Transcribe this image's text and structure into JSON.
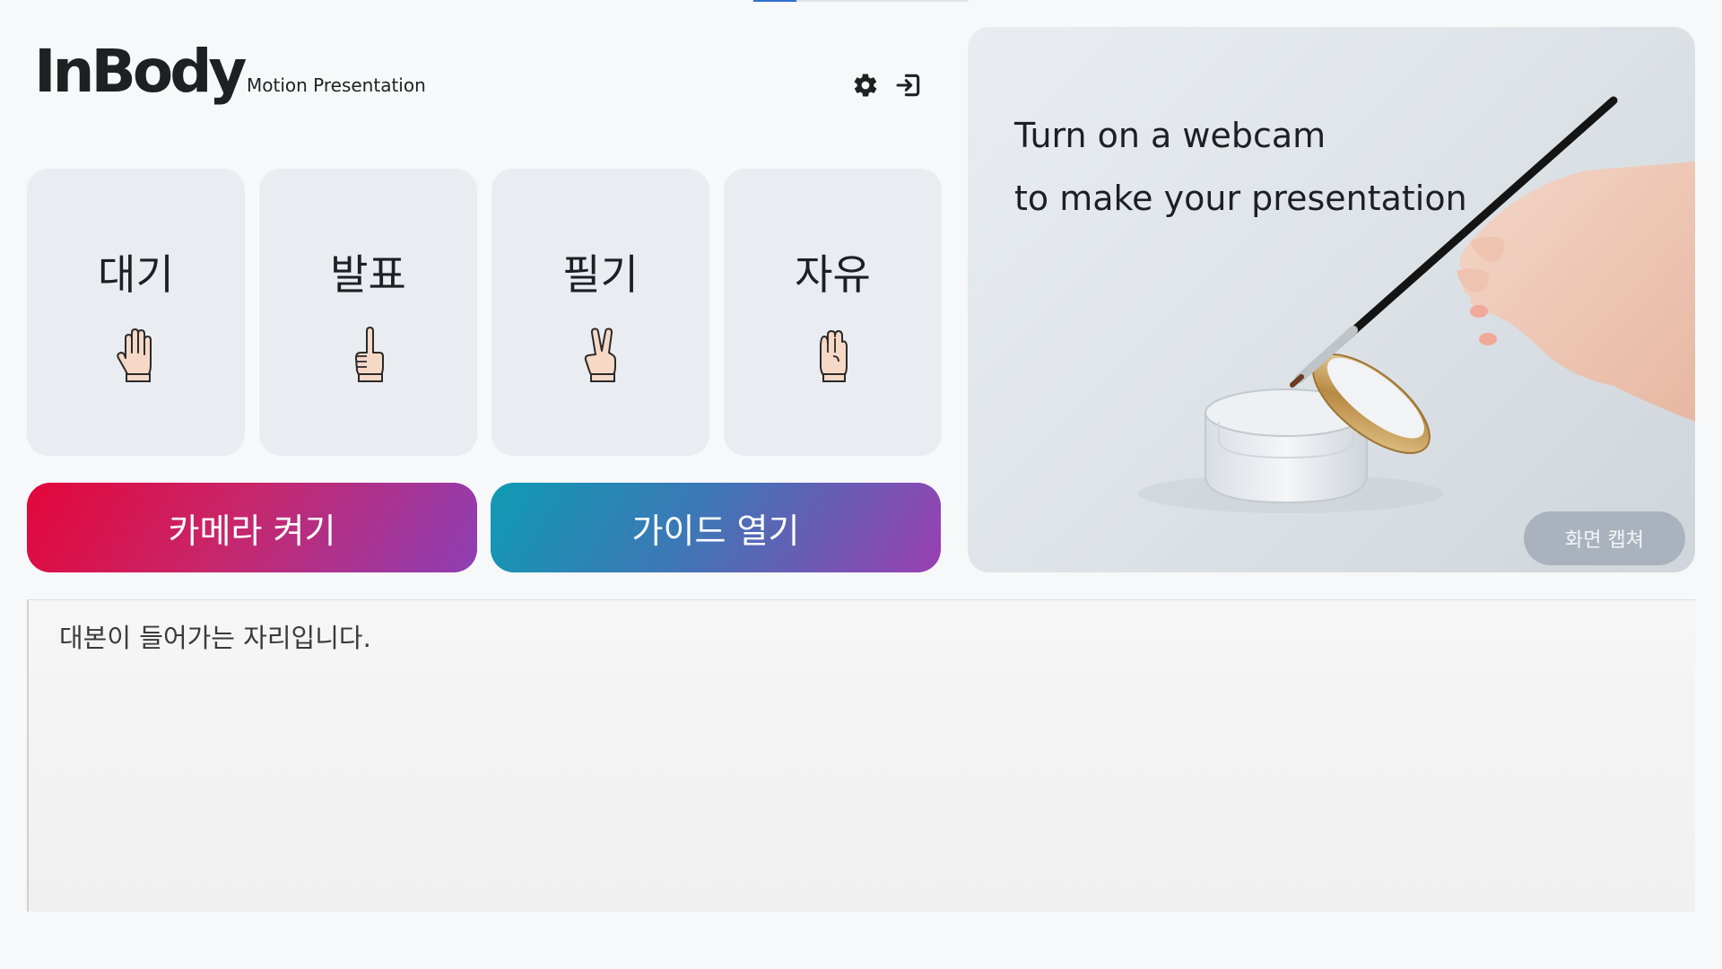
{
  "header": {
    "logo_text": "InBody",
    "subtitle": "Motion Presentation",
    "settings_icon": "gear-icon",
    "logout_icon": "sign-in-arrow-icon"
  },
  "modes": [
    {
      "label": "대기",
      "icon": "open-hand-icon"
    },
    {
      "label": "발표",
      "icon": "pointing-finger-icon"
    },
    {
      "label": "필기",
      "icon": "victory-hand-icon"
    },
    {
      "label": "자유",
      "icon": "fist-hand-icon"
    }
  ],
  "actions": {
    "camera_label": "카메라 켜기",
    "guide_label": "가이드 열기"
  },
  "preview": {
    "line1": "Turn on a webcam",
    "line2": "to make your presentation",
    "capture_label": "화면 캡쳐"
  },
  "script": {
    "placeholder": "대본이 들어가는 자리입니다."
  },
  "colors": {
    "camera_gradient": [
      "#e3063a",
      "#8e3fb5"
    ],
    "guide_gradient": [
      "#0f9bb3",
      "#9a3fb1"
    ],
    "card_bg": "#e9ecf0",
    "capture_bg": "#aab3bd"
  }
}
